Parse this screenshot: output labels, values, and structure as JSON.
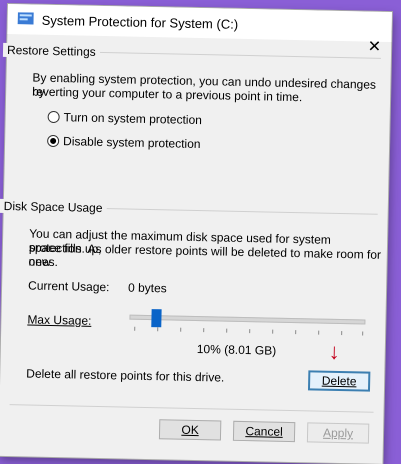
{
  "window": {
    "title": "System Protection for System (C:)"
  },
  "restore_settings": {
    "group_title": "Restore Settings",
    "description_line1": "By enabling system protection, you can undo undesired changes by",
    "description_line2": "reverting your computer to a previous point in time.",
    "options": [
      {
        "label": "Turn on system protection",
        "selected": false
      },
      {
        "label": "Disable system protection",
        "selected": true
      }
    ]
  },
  "disk_space": {
    "group_title": "Disk Space Usage",
    "description_line1": "You can adjust the maximum disk space used for system protection. As",
    "description_line2": "space fills up, older restore points will be deleted to make room for new",
    "description_line3": "ones.",
    "current_usage_label": "Current Usage:",
    "current_usage_value": "0 bytes",
    "max_usage_label": "Max Usage:",
    "max_usage_percent": 10,
    "max_usage_display": "10% (8.01 GB)",
    "delete_text": "Delete all restore points for this drive.",
    "delete_label": "Delete"
  },
  "footer": {
    "ok_label": "OK",
    "cancel_label": "Cancel",
    "apply_label": "Apply"
  },
  "colors": {
    "accent": "#0a64c8",
    "annotation_arrow": "#c3001c",
    "background": "#8a5fd6"
  }
}
